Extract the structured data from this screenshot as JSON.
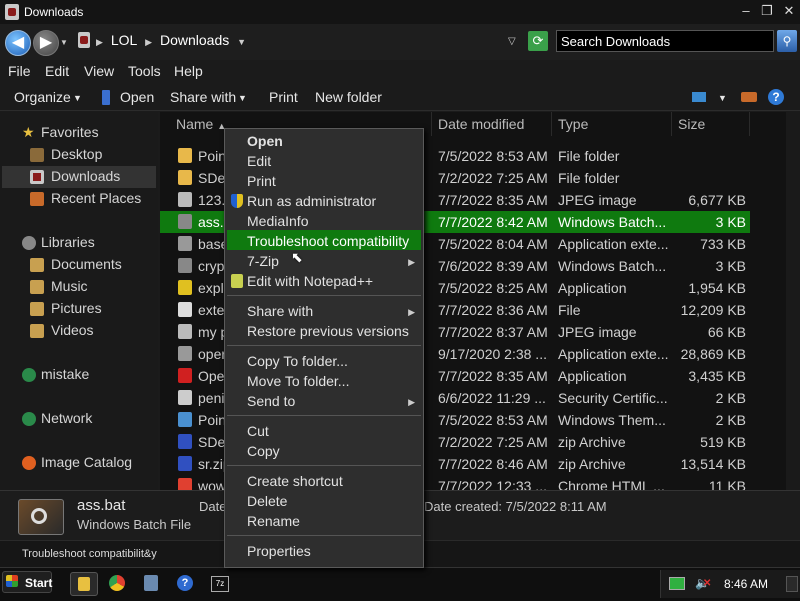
{
  "window": {
    "title": "Downloads"
  },
  "address": {
    "crumbs": [
      "LOL",
      "Downloads"
    ],
    "search_placeholder": "Search Downloads"
  },
  "menu": [
    "File",
    "Edit",
    "View",
    "Tools",
    "Help"
  ],
  "toolbar": {
    "organize": "Organize",
    "open": "Open",
    "share_with": "Share with",
    "print": "Print",
    "new_folder": "New folder"
  },
  "nav": {
    "favorites": "Favorites",
    "desktop": "Desktop",
    "downloads": "Downloads",
    "recent_places": "Recent Places",
    "libraries": "Libraries",
    "documents": "Documents",
    "music": "Music",
    "pictures": "Pictures",
    "videos": "Videos",
    "mistake": "mistake",
    "network": "Network",
    "image_catalog": "Image Catalog"
  },
  "columns": {
    "name": "Name",
    "date": "Date modified",
    "type": "Type",
    "size": "Size"
  },
  "files": [
    {
      "name": "Poin",
      "date": "7/5/2022 8:53 AM",
      "type": "File folder",
      "size": "",
      "icon_color": "#e8b84a"
    },
    {
      "name": "SDe",
      "date": "7/2/2022 7:25 AM",
      "type": "File folder",
      "size": "",
      "icon_color": "#e8b84a"
    },
    {
      "name": "123.",
      "date": "7/7/2022 8:35 AM",
      "type": "JPEG image",
      "size": "6,677 KB",
      "icon_color": "#bbbbbb"
    },
    {
      "name": "ass.",
      "date": "7/7/2022 8:42 AM",
      "type": "Windows Batch...",
      "size": "3 KB",
      "icon_color": "#888888"
    },
    {
      "name": "base",
      "date": "7/5/2022 8:04 AM",
      "type": "Application exte...",
      "size": "733 KB",
      "icon_color": "#999999"
    },
    {
      "name": "cryp",
      "date": "7/6/2022 8:39 AM",
      "type": "Windows Batch...",
      "size": "3 KB",
      "icon_color": "#888888"
    },
    {
      "name": "explo",
      "date": "7/5/2022 8:25 AM",
      "type": "Application",
      "size": "1,954 KB",
      "icon_color": "#e0c020"
    },
    {
      "name": "exte",
      "date": "7/7/2022 8:36 AM",
      "type": "File",
      "size": "12,209 KB",
      "icon_color": "#dddddd"
    },
    {
      "name": "my p",
      "date": "7/7/2022 8:37 AM",
      "type": "JPEG image",
      "size": "66 KB",
      "icon_color": "#bbbbbb"
    },
    {
      "name": "oper",
      "date": "9/17/2020 2:38 ...",
      "type": "Application exte...",
      "size": "28,869 KB",
      "icon_color": "#999999"
    },
    {
      "name": "Oper",
      "date": "7/7/2022 8:35 AM",
      "type": "Application",
      "size": "3,435 KB",
      "icon_color": "#d02020"
    },
    {
      "name": "penis",
      "date": "6/6/2022 11:29 ...",
      "type": "Security Certific...",
      "size": "2 KB",
      "icon_color": "#cccccc"
    },
    {
      "name": "Poin",
      "date": "7/5/2022 8:53 AM",
      "type": "Windows Them...",
      "size": "2 KB",
      "icon_color": "#4a90d0"
    },
    {
      "name": "SDe",
      "date": "7/2/2022 7:25 AM",
      "type": "zip Archive",
      "size": "519 KB",
      "icon_color": "#3050c0"
    },
    {
      "name": "sr.zip",
      "date": "7/7/2022 8:46 AM",
      "type": "zip Archive",
      "size": "13,514 KB",
      "icon_color": "#3050c0"
    },
    {
      "name": "wow",
      "date": "7/7/2022 12:33 ...",
      "type": "Chrome HTML ...",
      "size": "11 KB",
      "icon_color": "#e04030"
    }
  ],
  "context_menu": {
    "open": "Open",
    "edit": "Edit",
    "print": "Print",
    "run_as_admin": "Run as administrator",
    "mediainfo": "MediaInfo",
    "troubleshoot": "Troubleshoot compatibility",
    "seven_zip": "7-Zip",
    "edit_notepad": "Edit with Notepad++",
    "share_with": "Share with",
    "restore": "Restore previous versions",
    "copy_to": "Copy To folder...",
    "move_to": "Move To folder...",
    "send_to": "Send to",
    "cut": "Cut",
    "copy": "Copy",
    "create_shortcut": "Create shortcut",
    "delete": "Delete",
    "rename": "Rename",
    "properties": "Properties"
  },
  "details": {
    "name": "ass.bat",
    "type": "Windows Batch File",
    "date_label": "Date",
    "date_created": "Date created: 7/5/2022 8:11 AM"
  },
  "status": {
    "text": "Troubleshoot compatibilit&y"
  },
  "taskbar": {
    "start": "Start",
    "clock": "8:46 AM"
  }
}
